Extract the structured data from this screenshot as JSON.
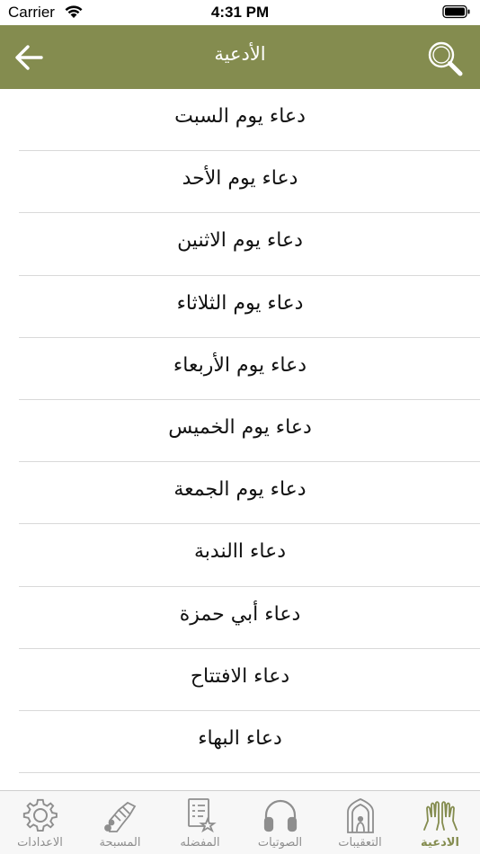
{
  "status_bar": {
    "carrier": "Carrier",
    "time": "4:31 PM"
  },
  "header": {
    "title": "الأدعية",
    "back_icon": "arrow-left-icon",
    "search_icon": "search-icon"
  },
  "colors": {
    "accent": "#848c4f",
    "tab_inactive": "#8e8e8e",
    "divider": "#d9d9d9"
  },
  "list": {
    "items": [
      {
        "label": "دعاء يوم السبت"
      },
      {
        "label": "دعاء يوم الأحد"
      },
      {
        "label": "دعاء يوم الاثنين"
      },
      {
        "label": "دعاء يوم الثلاثاء"
      },
      {
        "label": "دعاء يوم الأربعاء"
      },
      {
        "label": "دعاء يوم الخميس"
      },
      {
        "label": "دعاء يوم الجمعة"
      },
      {
        "label": "دعاء االندبة"
      },
      {
        "label": "دعاء أبي حمزة"
      },
      {
        "label": "دعاء الافتتاح"
      },
      {
        "label": "دعاء البهاء"
      },
      {
        "label": ""
      }
    ]
  },
  "tabs": [
    {
      "label": "الاعدادات",
      "icon": "gear-icon",
      "active": false
    },
    {
      "label": "المسبحة",
      "icon": "prayer-beads-icon",
      "active": false
    },
    {
      "label": "المفضله",
      "icon": "favorites-list-icon",
      "active": false
    },
    {
      "label": "الصوتيات",
      "icon": "headphones-icon",
      "active": false
    },
    {
      "label": "التعقيبات",
      "icon": "mihrab-icon",
      "active": false
    },
    {
      "label": "الادعية",
      "icon": "praying-hands-icon",
      "active": true
    }
  ]
}
